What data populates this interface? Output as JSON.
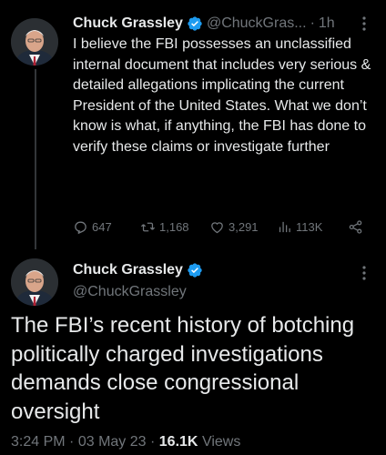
{
  "tweet1": {
    "author_name": "Chuck Grassley",
    "handle": "@ChuckGras...",
    "separator": "·",
    "time": "1h",
    "text": "I believe the FBI possesses an unclassified internal document that includes very serious & detailed allegations implicating the current President of the United States. What we don’t know is what, if anything, the FBI has done to verify these claims or investigate further",
    "replies": "647",
    "retweets": "1,168",
    "likes": "3,291",
    "views": "113K",
    "verified_color": "#1d9bf0"
  },
  "tweet2": {
    "author_name": "Chuck Grassley",
    "handle": "@ChuckGrassley",
    "text": "The FBI’s recent history of botching politically charged investigations demands close congressional oversight",
    "time": "3:24 PM",
    "separator1": "·",
    "date": "03 May 23",
    "separator2": "·",
    "views_count": "16.1K",
    "views_label": "Views"
  },
  "icons": [
    "verified-badge-icon",
    "more-icon",
    "reply-icon",
    "retweet-icon",
    "like-icon",
    "views-icon",
    "share-icon"
  ],
  "colors": {
    "background": "#000000",
    "text": "#e7e9ea",
    "muted": "#71767b",
    "accent": "#1d9bf0",
    "thread_line": "#333639"
  }
}
